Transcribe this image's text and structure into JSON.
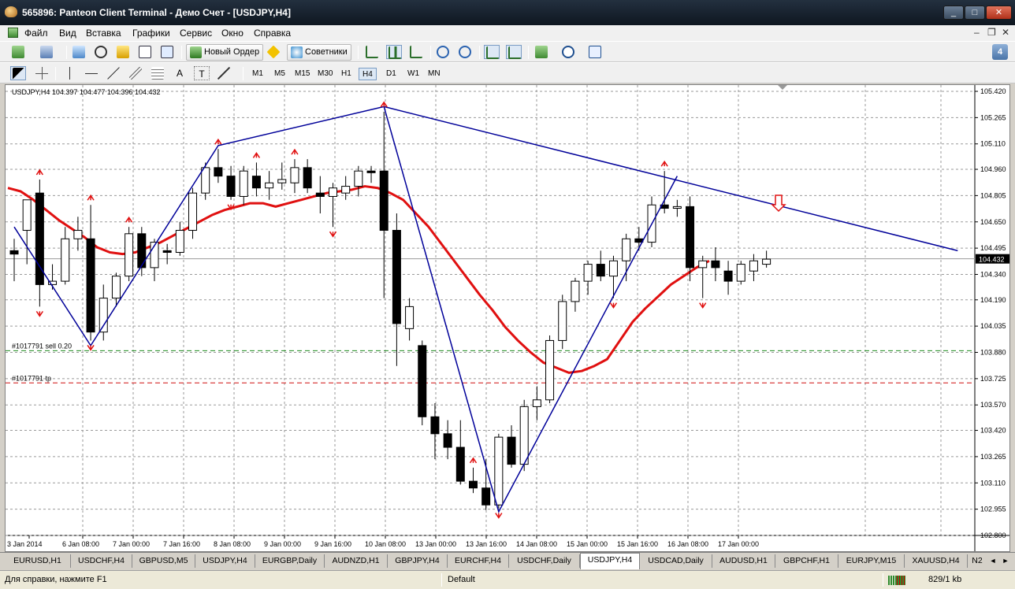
{
  "window": {
    "title": "565896: Panteon Client Terminal - Демо Счет - [USDJPY,H4]",
    "controls": {
      "minimize": "_",
      "maximize": "□",
      "close": "✕"
    }
  },
  "menu": {
    "items": [
      "Файл",
      "Вид",
      "Вставка",
      "Графики",
      "Сервис",
      "Окно",
      "Справка"
    ],
    "mdi_controls": [
      "–",
      "❐",
      "✕"
    ]
  },
  "toolbar": {
    "new_order_label": "Новый Ордер",
    "experts_label": "Советники",
    "side_badge": "4",
    "timeframes": [
      "M1",
      "M5",
      "M15",
      "M30",
      "H1",
      "H4",
      "D1",
      "W1",
      "MN"
    ],
    "active_timeframe": "H4",
    "drawing_tools": {
      "text_tool": "A",
      "text_label_tool": "T"
    },
    "icons": [
      "new-chart-icon",
      "profiles-icon",
      "market-watch-icon",
      "navigator-icon",
      "favorites-icon",
      "terminal-icon",
      "tester-icon",
      "new-order-icon",
      "alert-icon",
      "experts-icon",
      "bar-chart-icon",
      "candle-chart-icon",
      "line-chart-icon",
      "zoom-in-icon",
      "zoom-out-icon",
      "autoscroll-icon",
      "chart-shift-icon",
      "indicators-icon",
      "periods-icon",
      "templates-icon",
      "cursor-icon",
      "crosshair-icon",
      "vertical-line-icon",
      "horizontal-line-icon",
      "trendline-icon",
      "fibo-fan-icon",
      "fibo-retracement-icon",
      "text-icon",
      "text-label-icon",
      "arrows-icon"
    ]
  },
  "chart_info": {
    "symbol": "USDJPY,H4",
    "ohlc": "104.397 104.477 104.396 104.432",
    "full": "USDJPY,H4  104.397 104.477 104.396 104.432"
  },
  "chart_data": {
    "type": "candlestick",
    "symbol": "USDJPY",
    "timeframe": "H4",
    "ylim": [
      102.8,
      105.42
    ],
    "y_ticks": [
      "105.420",
      "105.265",
      "105.110",
      "104.960",
      "104.805",
      "104.650",
      "104.495",
      "104.340",
      "104.190",
      "104.035",
      "103.880",
      "103.725",
      "103.570",
      "103.420",
      "103.265",
      "103.110",
      "102.955",
      "102.800"
    ],
    "x_ticks": [
      "3 Jan 2014",
      "6 Jan 08:00",
      "7 Jan 00:00",
      "7 Jan 16:00",
      "8 Jan 08:00",
      "9 Jan 00:00",
      "9 Jan 16:00",
      "10 Jan 08:00",
      "13 Jan 00:00",
      "13 Jan 16:00",
      "14 Jan 08:00",
      "15 Jan 00:00",
      "15 Jan 16:00",
      "16 Jan 08:00",
      "17 Jan 00:00"
    ],
    "current_price": "104.432",
    "candles": [
      {
        "o": 104.48,
        "h": 104.55,
        "l": 104.3,
        "c": 104.46
      },
      {
        "o": 104.6,
        "h": 104.75,
        "l": 104.4,
        "c": 104.78
      },
      {
        "o": 104.82,
        "h": 104.9,
        "l": 104.15,
        "c": 104.28
      },
      {
        "o": 104.28,
        "h": 104.4,
        "l": 104.25,
        "c": 104.3
      },
      {
        "o": 104.3,
        "h": 104.62,
        "l": 104.28,
        "c": 104.55
      },
      {
        "o": 104.55,
        "h": 104.68,
        "l": 104.48,
        "c": 104.6
      },
      {
        "o": 104.55,
        "h": 104.75,
        "l": 103.95,
        "c": 104.0
      },
      {
        "o": 104.0,
        "h": 104.28,
        "l": 103.95,
        "c": 104.2
      },
      {
        "o": 104.2,
        "h": 104.35,
        "l": 104.15,
        "c": 104.33
      },
      {
        "o": 104.33,
        "h": 104.62,
        "l": 104.3,
        "c": 104.58
      },
      {
        "o": 104.58,
        "h": 104.62,
        "l": 104.33,
        "c": 104.38
      },
      {
        "o": 104.38,
        "h": 104.55,
        "l": 104.3,
        "c": 104.53
      },
      {
        "o": 104.48,
        "h": 104.52,
        "l": 104.4,
        "c": 104.47
      },
      {
        "o": 104.47,
        "h": 104.65,
        "l": 104.45,
        "c": 104.6
      },
      {
        "o": 104.6,
        "h": 104.85,
        "l": 104.55,
        "c": 104.82
      },
      {
        "o": 104.82,
        "h": 105.0,
        "l": 104.78,
        "c": 104.97
      },
      {
        "o": 104.97,
        "h": 105.08,
        "l": 104.88,
        "c": 104.92
      },
      {
        "o": 104.92,
        "h": 104.98,
        "l": 104.78,
        "c": 104.8
      },
      {
        "o": 104.8,
        "h": 104.98,
        "l": 104.75,
        "c": 104.95
      },
      {
        "o": 104.92,
        "h": 105.0,
        "l": 104.8,
        "c": 104.85
      },
      {
        "o": 104.85,
        "h": 104.95,
        "l": 104.78,
        "c": 104.88
      },
      {
        "o": 104.88,
        "h": 105.0,
        "l": 104.84,
        "c": 104.9
      },
      {
        "o": 104.88,
        "h": 105.02,
        "l": 104.82,
        "c": 104.97
      },
      {
        "o": 104.97,
        "h": 105.02,
        "l": 104.82,
        "c": 104.85
      },
      {
        "o": 104.82,
        "h": 104.92,
        "l": 104.7,
        "c": 104.8
      },
      {
        "o": 104.8,
        "h": 104.88,
        "l": 104.62,
        "c": 104.85
      },
      {
        "o": 104.82,
        "h": 104.92,
        "l": 104.78,
        "c": 104.86
      },
      {
        "o": 104.86,
        "h": 104.98,
        "l": 104.8,
        "c": 104.95
      },
      {
        "o": 104.95,
        "h": 104.98,
        "l": 104.88,
        "c": 104.94
      },
      {
        "o": 104.95,
        "h": 105.3,
        "l": 104.2,
        "c": 104.6
      },
      {
        "o": 104.6,
        "h": 104.7,
        "l": 103.8,
        "c": 104.05
      },
      {
        "o": 104.02,
        "h": 104.2,
        "l": 103.95,
        "c": 104.15
      },
      {
        "o": 103.92,
        "h": 103.95,
        "l": 103.45,
        "c": 103.5
      },
      {
        "o": 103.5,
        "h": 103.58,
        "l": 103.25,
        "c": 103.4
      },
      {
        "o": 103.4,
        "h": 103.48,
        "l": 103.25,
        "c": 103.32
      },
      {
        "o": 103.32,
        "h": 103.48,
        "l": 103.1,
        "c": 103.12
      },
      {
        "o": 103.12,
        "h": 103.2,
        "l": 103.05,
        "c": 103.08
      },
      {
        "o": 103.08,
        "h": 103.25,
        "l": 102.95,
        "c": 102.98
      },
      {
        "o": 102.98,
        "h": 103.4,
        "l": 102.96,
        "c": 103.38
      },
      {
        "o": 103.38,
        "h": 103.45,
        "l": 103.2,
        "c": 103.22
      },
      {
        "o": 103.22,
        "h": 103.6,
        "l": 103.18,
        "c": 103.56
      },
      {
        "o": 103.56,
        "h": 103.68,
        "l": 103.48,
        "c": 103.6
      },
      {
        "o": 103.6,
        "h": 103.98,
        "l": 103.58,
        "c": 103.95
      },
      {
        "o": 103.95,
        "h": 104.22,
        "l": 103.9,
        "c": 104.18
      },
      {
        "o": 104.18,
        "h": 104.32,
        "l": 104.12,
        "c": 104.3
      },
      {
        "o": 104.3,
        "h": 104.42,
        "l": 104.22,
        "c": 104.4
      },
      {
        "o": 104.4,
        "h": 104.48,
        "l": 104.3,
        "c": 104.33
      },
      {
        "o": 104.33,
        "h": 104.45,
        "l": 104.2,
        "c": 104.42
      },
      {
        "o": 104.42,
        "h": 104.58,
        "l": 104.3,
        "c": 104.55
      },
      {
        "o": 104.55,
        "h": 104.62,
        "l": 104.48,
        "c": 104.53
      },
      {
        "o": 104.53,
        "h": 104.8,
        "l": 104.5,
        "c": 104.75
      },
      {
        "o": 104.75,
        "h": 104.95,
        "l": 104.7,
        "c": 104.73
      },
      {
        "o": 104.73,
        "h": 104.78,
        "l": 104.68,
        "c": 104.74
      },
      {
        "o": 104.74,
        "h": 104.8,
        "l": 104.3,
        "c": 104.38
      },
      {
        "o": 104.38,
        "h": 104.45,
        "l": 104.2,
        "c": 104.42
      },
      {
        "o": 104.42,
        "h": 104.5,
        "l": 104.3,
        "c": 104.38
      },
      {
        "o": 104.36,
        "h": 104.42,
        "l": 104.22,
        "c": 104.3
      },
      {
        "o": 104.3,
        "h": 104.42,
        "l": 104.28,
        "c": 104.4
      },
      {
        "o": 104.36,
        "h": 104.46,
        "l": 104.3,
        "c": 104.42
      },
      {
        "o": 104.4,
        "h": 104.48,
        "l": 104.38,
        "c": 104.43
      }
    ],
    "moving_average": [
      104.85,
      104.83,
      104.78,
      104.72,
      104.66,
      104.61,
      104.56,
      104.5,
      104.47,
      104.46,
      104.47,
      104.5,
      104.53,
      104.57,
      104.61,
      104.65,
      104.69,
      104.72,
      104.74,
      104.76,
      104.76,
      104.74,
      104.76,
      104.78,
      104.8,
      104.82,
      104.83,
      104.84,
      104.86,
      104.85,
      104.82,
      104.78,
      104.7,
      104.62,
      104.52,
      104.42,
      104.32,
      104.22,
      104.13,
      104.03,
      103.95,
      103.88,
      103.82,
      103.79,
      103.76,
      103.77,
      103.8,
      103.84,
      103.95,
      104.06,
      104.14,
      104.21,
      104.28,
      104.33,
      104.38,
      104.42
    ],
    "zigzag": [
      {
        "i": 0,
        "p": 104.62
      },
      {
        "i": 6,
        "p": 103.92
      },
      {
        "i": 16,
        "p": 105.1
      },
      {
        "i": 29,
        "p": 105.33
      },
      {
        "i": 38,
        "p": 102.94
      },
      {
        "i": 52,
        "p": 104.92
      }
    ],
    "trendline": {
      "from": {
        "i": 29,
        "p": 105.33
      },
      "to": {
        "i": 74,
        "p": 104.48
      }
    },
    "fractal_up_indices": [
      2,
      6,
      9,
      16,
      19,
      22,
      29,
      36,
      51
    ],
    "fractal_down_indices": [
      2,
      6,
      17,
      25,
      38,
      47,
      54
    ],
    "orders": [
      {
        "label": "#1017791 sell 0.20",
        "price": 103.89,
        "color": "#1a8a1a"
      },
      {
        "label": "#1017791 tp",
        "price": 103.7,
        "color": "#d01010"
      }
    ],
    "colors": {
      "bull": "#ffffff",
      "bear": "#000000",
      "ma": "#e01010",
      "zigzag": "#000099",
      "fractal": "#e01010",
      "grid": "#9a9a9a"
    }
  },
  "tabs": {
    "items": [
      "EURUSD,H1",
      "USDCHF,H4",
      "GBPUSD,M5",
      "USDJPY,H4",
      "EURGBP,Daily",
      "AUDNZD,H1",
      "GBPJPY,H4",
      "EURCHF,H4",
      "USDCHF,Daily",
      "USDJPY,H4",
      "USDCAD,Daily",
      "AUDUSD,H1",
      "GBPCHF,H1",
      "EURJPY,M15",
      "XAUUSD,H4",
      "N2"
    ],
    "active_index": 9,
    "arrows": [
      "◄",
      "►"
    ]
  },
  "status": {
    "help": "Для справки, нажмите F1",
    "profile": "Default",
    "traffic": "829/1 kb"
  }
}
